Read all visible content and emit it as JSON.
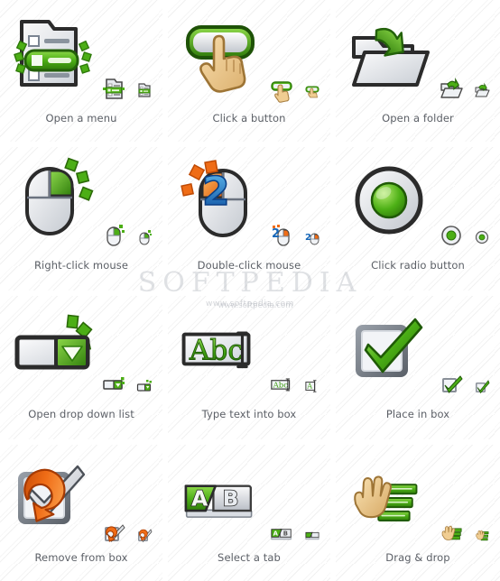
{
  "watermark": {
    "brand": "SOFTPEDIA",
    "url": "www.softpedia.com",
    "url_top": "www.softpedia.com"
  },
  "grid": {
    "columns": 3,
    "rows": 4,
    "sizes": [
      "large",
      "medium",
      "small"
    ]
  },
  "colors": {
    "green_light": "#9ede4b",
    "green": "#46a714",
    "green_dark": "#2f7a0b",
    "orange_light": "#ffb25e",
    "orange": "#ef6c16",
    "orange_dark": "#c44a05",
    "blue": "#1a6fc4",
    "skin": "#f0cd92",
    "skin_dark": "#c9a065",
    "grey_light": "#f2f2f2",
    "grey": "#c9ccd1",
    "grey_dark": "#3d3d3d",
    "outline": "#2b2b2b",
    "label_text": "#5b5f66",
    "background": "#ffffff"
  },
  "cells": [
    {
      "id": "open-a-menu",
      "label": "Open a menu",
      "icon": "menu-icon",
      "row": 1,
      "col": 1
    },
    {
      "id": "click-a-button",
      "label": "Click a button",
      "icon": "button-click-icon",
      "row": 1,
      "col": 2
    },
    {
      "id": "open-a-folder",
      "label": "Open a folder",
      "icon": "folder-open-icon",
      "row": 1,
      "col": 3
    },
    {
      "id": "right-click-mouse",
      "label": "Right-click mouse",
      "icon": "mouse-right-icon",
      "row": 2,
      "col": 1
    },
    {
      "id": "double-click-mouse",
      "label": "Double-click mouse",
      "icon": "mouse-double-icon",
      "row": 2,
      "col": 2,
      "badge": "2"
    },
    {
      "id": "click-radio-button",
      "label": "Click radio button",
      "icon": "radio-button-icon",
      "row": 2,
      "col": 3
    },
    {
      "id": "open-drop-down-list",
      "label": "Open drop down list",
      "icon": "dropdown-icon",
      "row": 3,
      "col": 1
    },
    {
      "id": "type-text-into-box",
      "label": "Type text into box",
      "icon": "textbox-icon",
      "row": 3,
      "col": 2,
      "text": "Abc"
    },
    {
      "id": "place-in-box",
      "label": "Place in box",
      "icon": "checkbox-checked-icon",
      "row": 3,
      "col": 3
    },
    {
      "id": "remove-from-box",
      "label": "Remove from box",
      "icon": "checkbox-remove-icon",
      "row": 4,
      "col": 1
    },
    {
      "id": "select-a-tab",
      "label": "Select a tab",
      "icon": "tabs-icon",
      "row": 4,
      "col": 2,
      "tab_a": "A",
      "tab_b": "B"
    },
    {
      "id": "drag-and-drop",
      "label": "Drag & drop",
      "icon": "drag-drop-icon",
      "row": 4,
      "col": 3
    }
  ]
}
